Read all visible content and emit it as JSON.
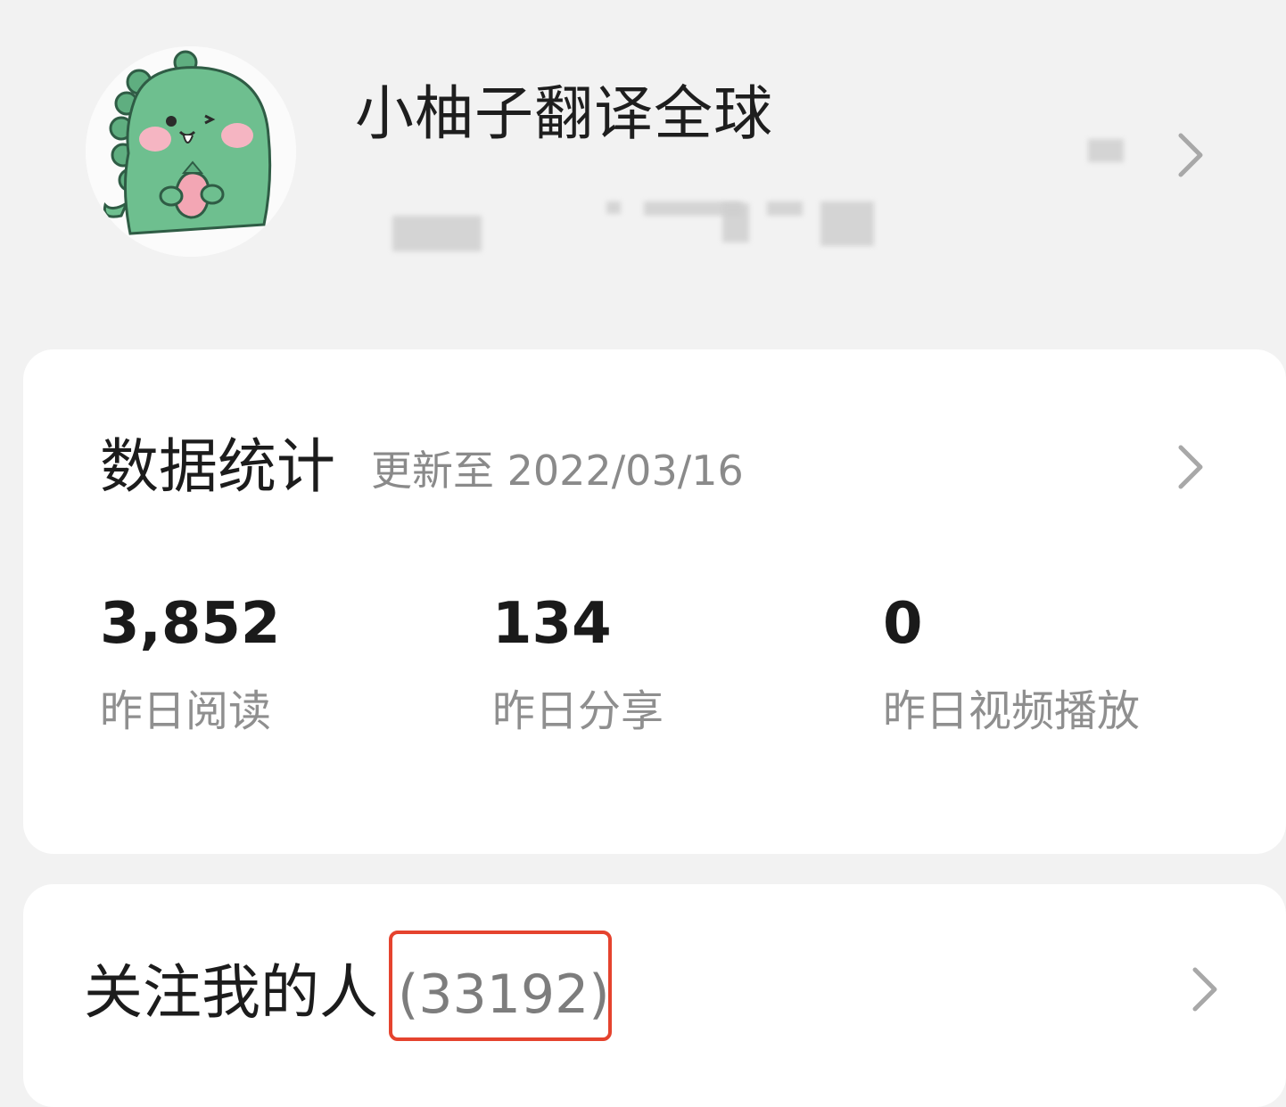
{
  "profile": {
    "name": "小柚子翻译全球",
    "avatar_icon": "green-dinosaur-avatar"
  },
  "stats": {
    "title": "数据统计",
    "updated": "更新至 2022/03/16",
    "items": [
      {
        "value": "3,852",
        "label": "昨日阅读"
      },
      {
        "value": "134",
        "label": "昨日分享"
      },
      {
        "value": "0",
        "label": "昨日视频播放"
      }
    ]
  },
  "followers": {
    "label": "关注我的人",
    "count": "(33192)",
    "highlight_color": "#e5432e"
  },
  "icons": {
    "chevron": "chevron-right-icon"
  }
}
